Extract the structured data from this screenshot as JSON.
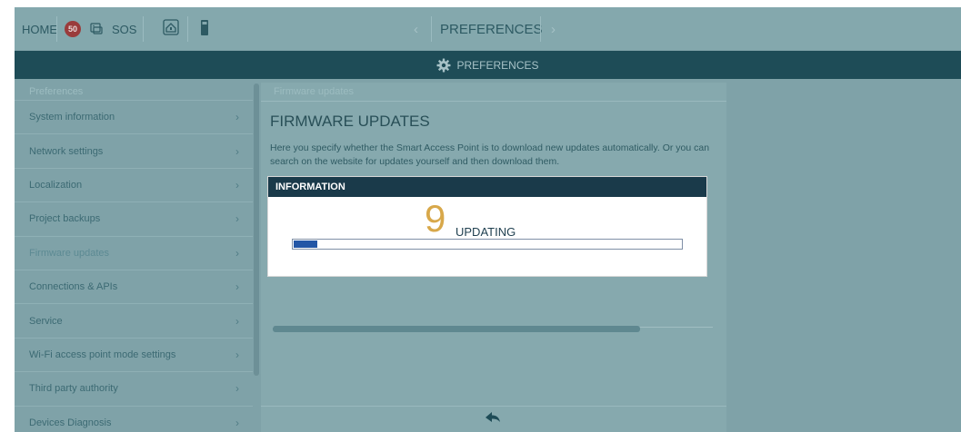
{
  "topbar": {
    "home_label": "HOME",
    "notification_count": "50",
    "sos_label": "SOS",
    "title": "PREFERENCES",
    "prev_icon": "chevron-left-icon",
    "next_icon": "chevron-right-icon"
  },
  "header": {
    "title": "PREFERENCES",
    "icon": "gear-icon"
  },
  "sidebar": {
    "heading": "Preferences",
    "items": [
      {
        "label": "System information"
      },
      {
        "label": "Network settings"
      },
      {
        "label": "Localization"
      },
      {
        "label": "Project backups"
      },
      {
        "label": "Firmware updates"
      },
      {
        "label": "Connections & APIs"
      },
      {
        "label": "Service"
      },
      {
        "label": "Wi-Fi access point mode settings"
      },
      {
        "label": "Third party authority"
      },
      {
        "label": "Devices Diagnosis"
      }
    ],
    "active_index": 4
  },
  "content": {
    "breadcrumb": "Firmware updates",
    "title": "FIRMWARE UPDATES",
    "description": "Here you specify whether the Smart Access Point is to download new updates automatically. Or you can search on the website for updates yourself and then download them."
  },
  "dialog": {
    "title": "INFORMATION",
    "count": "9",
    "status": "UPDATING",
    "progress": 0.06
  },
  "colors": {
    "header_bg": "#1e4c57",
    "dialog_header_bg": "#1a3a4a",
    "progress_fill": "#2356a6",
    "counter_color": "#d8a84a",
    "badge_red": "#9a3b3b"
  }
}
